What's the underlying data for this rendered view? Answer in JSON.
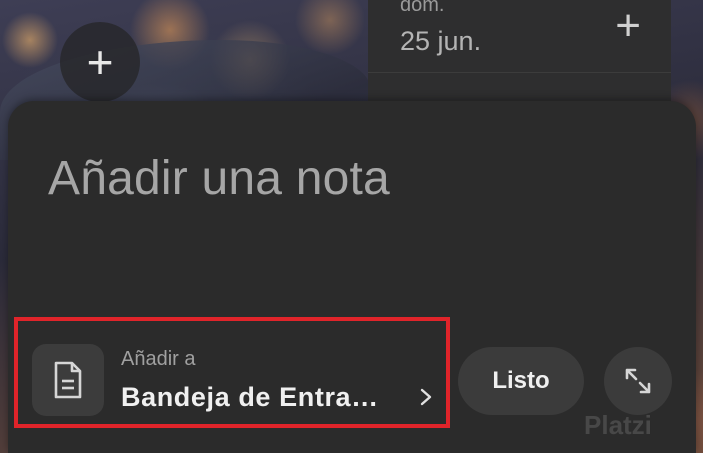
{
  "background": {
    "fab_icon": "plus-icon"
  },
  "calendar": {
    "day": "dom.",
    "date": "25 jun.",
    "add_icon": "plus-icon"
  },
  "note": {
    "placeholder": "Añadir una nota",
    "add_to_label": "Añadir a",
    "destination": "Bandeja de Entra…",
    "destination_icon": "document-icon",
    "chevron_icon": "chevron-right-icon",
    "done_label": "Listo",
    "expand_icon": "expand-icon"
  },
  "watermark": "Platzi",
  "colors": {
    "highlight": "#e0242a",
    "sheet": "#2b2b2b"
  }
}
